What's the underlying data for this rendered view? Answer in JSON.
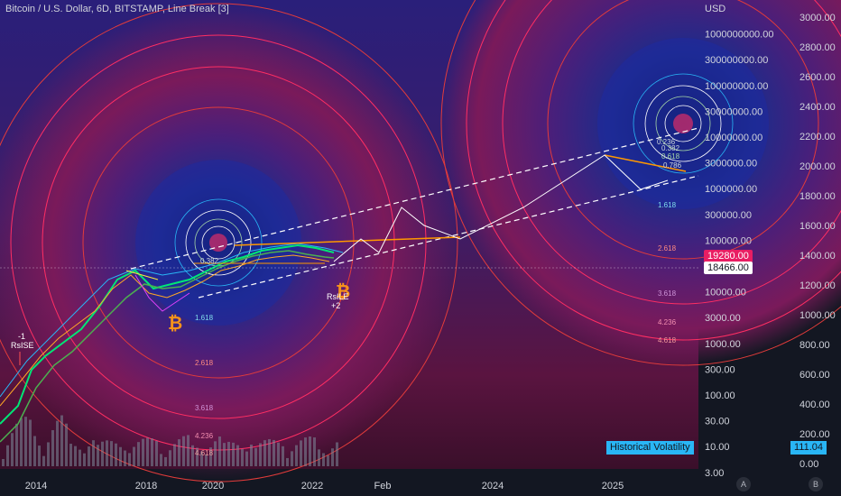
{
  "header": {
    "title": "Bitcoin / U.S. Dollar, 6D, BITSTAMP, Line Break [3]"
  },
  "colors": {
    "background": "#131722",
    "accent_orange": "#f7931a",
    "ring_pink": "#ff2e63",
    "ring_red": "#e23b3b",
    "trend_orange": "#ff9800",
    "volatility_blue": "#29b6f6",
    "price_pink": "#e91e63"
  },
  "price_tags": {
    "current": "19280.00",
    "secondary": "18466.00"
  },
  "volatility": {
    "label": "Historical Volatility",
    "value": "111.04"
  },
  "corner_buttons": {
    "auto": "A",
    "log": "B"
  },
  "annotations": {
    "left_signal": "-1\nRsISE",
    "right_signal": "RsILE\n+2"
  },
  "chart_data": [
    {
      "type": "line",
      "title": "Bitcoin / U.S. Dollar, 6D, BITSTAMP, Line Break [3]",
      "y_axis_log_labels": [
        "USD",
        "1000000000.00",
        "300000000.00",
        "100000000.00",
        "30000000.00",
        "10000000.00",
        "3000000.00",
        "1000000.00",
        "300000.00",
        "100000.00",
        "30000.00",
        "10000.00",
        "3000.00",
        "1000.00",
        "300.00",
        "100.00",
        "30.00",
        "10.00",
        "3.00"
      ],
      "x_ticks": [
        "2014",
        "2018",
        "2020",
        "2022",
        "Feb",
        "2024",
        "2025"
      ],
      "scale": "log",
      "series": [
        {
          "name": "",
          "x": [
            "2014",
            "2018",
            "2020",
            "2022",
            "Feb"
          ],
          "y": [
            300,
            3000,
            10000,
            30000,
            19280
          ]
        }
      ],
      "fibonacci_levels_left": [
        "0.382",
        "1.618",
        "2.618",
        "3.618",
        "4.236",
        "4.618"
      ],
      "fibonacci_levels_right": [
        "0.236",
        "0.382",
        "0.618",
        "0.786",
        "1.618",
        "2.618",
        "3.618",
        "4.236",
        "4.618"
      ]
    },
    {
      "type": "bar",
      "title": "Historical Volatility",
      "y_axis_labels": [
        "3000.00",
        "2800.00",
        "2600.00",
        "2400.00",
        "2200.00",
        "2000.00",
        "1800.00",
        "1600.00",
        "1400.00",
        "1200.00",
        "1000.00",
        "800.00",
        "600.00",
        "400.00",
        "200.00",
        "0.00"
      ],
      "last_value": 111.04
    }
  ]
}
